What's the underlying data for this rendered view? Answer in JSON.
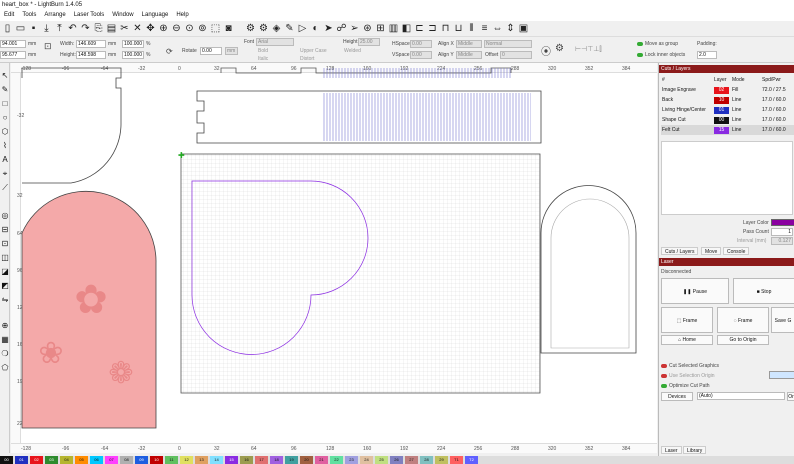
{
  "window": {
    "title": "heart_box * - LightBurn 1.4.05"
  },
  "menu": [
    "Edit",
    "Tools",
    "Arrange",
    "Laser Tools",
    "Window",
    "Language",
    "Help"
  ],
  "toolbar2": {
    "x_val": "94.001",
    "y_val": "95.677",
    "mm1": "mm",
    "mm2": "mm",
    "width_label": "Width:",
    "width_val": "146.609",
    "height_label": "Height:",
    "height_val": "148.598",
    "pct1": "100.000",
    "pct2": "100.000",
    "pct_unit": "%",
    "rotate_label": "Rotate",
    "rotate_val": "0.00",
    "rotate_unit": "mm",
    "font_label": "Font",
    "font_val": "Arial",
    "bold": "Bold",
    "italic": "Italic",
    "upper_case": "Upper Case",
    "welded": "Welded",
    "distort": "Distort",
    "height2_label": "Height",
    "height2_val": "25.00",
    "hspace_label": "HSpace",
    "hspace_val": "0.00",
    "vspace_label": "VSpace",
    "vspace_val": "0.00",
    "alignx_label": "Align X",
    "alignx_val": "Middle",
    "normal_val": "Normal",
    "aligny_label": "Align Y",
    "aligny_val": "Middle",
    "offset_label": "Offset",
    "offset_val": "0",
    "move_as_group": "Move as group",
    "lock_inner": "Lock inner objects",
    "padding_label": "Padding:",
    "padding_val": "2.0"
  },
  "ruler": {
    "top_ticks": [
      "-128",
      "-96",
      "-64",
      "-32",
      "0",
      "32",
      "64",
      "96",
      "128",
      "160",
      "192",
      "224",
      "256",
      "288",
      "320",
      "352",
      "384"
    ],
    "left_ticks": [
      "0",
      "-32",
      "32",
      "64",
      "96",
      "128",
      "160",
      "192",
      "224"
    ],
    "bottom_ticks": [
      "-128",
      "-96",
      "-64",
      "-32",
      "0",
      "32",
      "64",
      "96",
      "128",
      "160",
      "192",
      "224",
      "256",
      "288",
      "320",
      "352",
      "384"
    ]
  },
  "cuts_layers": {
    "header": "Cuts / Layers",
    "columns": [
      "#",
      "Layer",
      "Mode",
      "Spd/Pwr"
    ],
    "rows": [
      {
        "name": "Image Engrave",
        "layer": "02",
        "color": "#e8141b",
        "mode": "Fill",
        "spd": "72.0 / 27.5"
      },
      {
        "name": "Back",
        "layer": "10",
        "color": "#c00000",
        "mode": "Line",
        "spd": "17.0 / 60.0"
      },
      {
        "name": "Living Hinge/Center",
        "layer": "01",
        "color": "#2030c0",
        "mode": "Line",
        "spd": "17.0 / 60.0"
      },
      {
        "name": "Shape Cut",
        "layer": "00",
        "color": "#111111",
        "mode": "Line",
        "spd": "17.0 / 60.0"
      },
      {
        "name": "Felt Cut",
        "layer": "15",
        "color": "#8a2be2",
        "mode": "Line",
        "spd": "17.0 / 60.0"
      }
    ],
    "layer_color_label": "Layer Color",
    "layer_color": "#8a00a0",
    "pass_count_label": "Pass Count",
    "pass_count_val": "1",
    "interval_label": "Interval (mm)",
    "interval_val": "0.127"
  },
  "tabs_top": [
    "Cuts / Layers",
    "Move",
    "Console"
  ],
  "laser": {
    "header": "Laser",
    "status": "Disconnected",
    "pause": "Pause",
    "stop": "Stop",
    "frame1": "Frame",
    "frame2": "Frame",
    "save": "Save G",
    "home": "Home",
    "go_origin": "Go to Origin",
    "cut_selected": "Cut Selected Graphics",
    "use_selection": "Use Selection Origin",
    "optimize": "Optimize Cut Path",
    "devices": "Devices",
    "device_val": "(Auto)",
    "origin_short": "Or"
  },
  "tabs_bottom": [
    "Laser",
    "Library"
  ],
  "palette": [
    {
      "label": "00",
      "color": "#111111"
    },
    {
      "label": "01",
      "color": "#2030c0"
    },
    {
      "label": "02",
      "color": "#e8141b"
    },
    {
      "label": "03",
      "color": "#2e8b2e"
    },
    {
      "label": "04",
      "color": "#b5b52e"
    },
    {
      "label": "05",
      "color": "#ff8c00"
    },
    {
      "label": "06",
      "color": "#00c8ff"
    },
    {
      "label": "07",
      "color": "#ff40ff"
    },
    {
      "label": "08",
      "color": "#b0b0b0"
    },
    {
      "label": "09",
      "color": "#1e5ee0"
    },
    {
      "label": "10",
      "color": "#c00000"
    },
    {
      "label": "11",
      "color": "#60c060"
    },
    {
      "label": "12",
      "color": "#e0e060"
    },
    {
      "label": "13",
      "color": "#e0a060"
    },
    {
      "label": "14",
      "color": "#80e0ff"
    },
    {
      "label": "15",
      "color": "#8a2be2"
    },
    {
      "label": "16",
      "color": "#9c9c50"
    },
    {
      "label": "17",
      "color": "#e07070"
    },
    {
      "label": "18",
      "color": "#a060e0"
    },
    {
      "label": "19",
      "color": "#40a0a0"
    },
    {
      "label": "20",
      "color": "#a06040"
    },
    {
      "label": "21",
      "color": "#e060a0"
    },
    {
      "label": "22",
      "color": "#60e0a0"
    },
    {
      "label": "23",
      "color": "#a0a0e0"
    },
    {
      "label": "24",
      "color": "#e0c0a0"
    },
    {
      "label": "25",
      "color": "#c0e080"
    },
    {
      "label": "26",
      "color": "#8080c0"
    },
    {
      "label": "27",
      "color": "#c08080"
    },
    {
      "label": "28",
      "color": "#80c0c0"
    },
    {
      "label": "29",
      "color": "#c0c060"
    },
    {
      "label": "T1",
      "color": "#ff6060"
    },
    {
      "label": "T2",
      "color": "#6060ff"
    }
  ]
}
